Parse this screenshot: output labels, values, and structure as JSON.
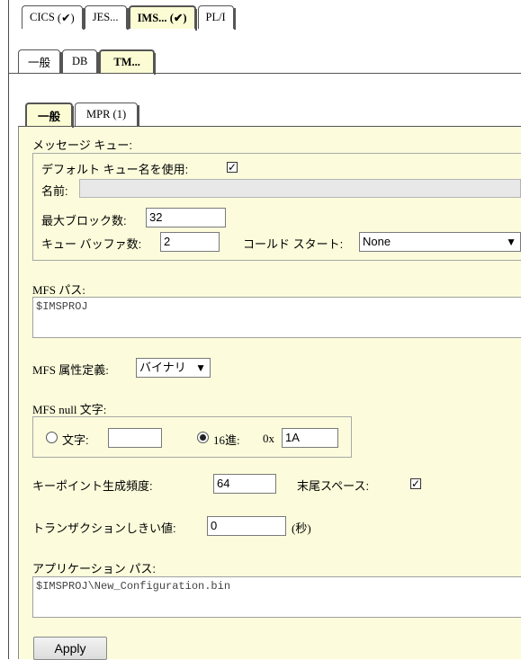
{
  "top_tabs": [
    {
      "label": "CICS",
      "check": "(✔)"
    },
    {
      "label": "JES...",
      "check": ""
    },
    {
      "label": "IMS...",
      "check": "(✔)"
    },
    {
      "label": "PL/I",
      "check": ""
    }
  ],
  "sub_tabs": [
    "一般",
    "DB",
    "TM..."
  ],
  "inner_tabs": [
    "一般",
    "MPR (1)"
  ],
  "message_queue": {
    "heading": "メッセージ キュー:",
    "use_default_label": "デフォルト キュー名を使用:",
    "use_default_checked": "✓",
    "name_label": "名前:",
    "name_value": "",
    "max_blocks_label": "最大ブロック数:",
    "max_blocks_value": "32",
    "buffers_label": "キュー バッファ数:",
    "buffers_value": "2",
    "cold_start_label": "コールド スタート:",
    "cold_start_value": "None"
  },
  "mfs_path": {
    "label": "MFS パス:",
    "value": "$IMSPROJ"
  },
  "mfs_attr": {
    "label": "MFS 属性定義:",
    "value": "バイナリ"
  },
  "mfs_null": {
    "label": "MFS null 文字:",
    "char_label": "文字:",
    "char_value": "",
    "hex_label": "16進:",
    "hex_prefix": "0x",
    "hex_value": "1A"
  },
  "checkpoint": {
    "label": "キーポイント生成頻度:",
    "value": "64"
  },
  "trailing_space": {
    "label": "末尾スペース:",
    "checked": "✓"
  },
  "transaction": {
    "label": "トランザクションしきい値:",
    "value": "0",
    "unit": "(秒)"
  },
  "app_path": {
    "label": "アプリケーション パス:",
    "value": "$IMSPROJ\\New_Configuration.bin"
  },
  "apply_label": "Apply"
}
